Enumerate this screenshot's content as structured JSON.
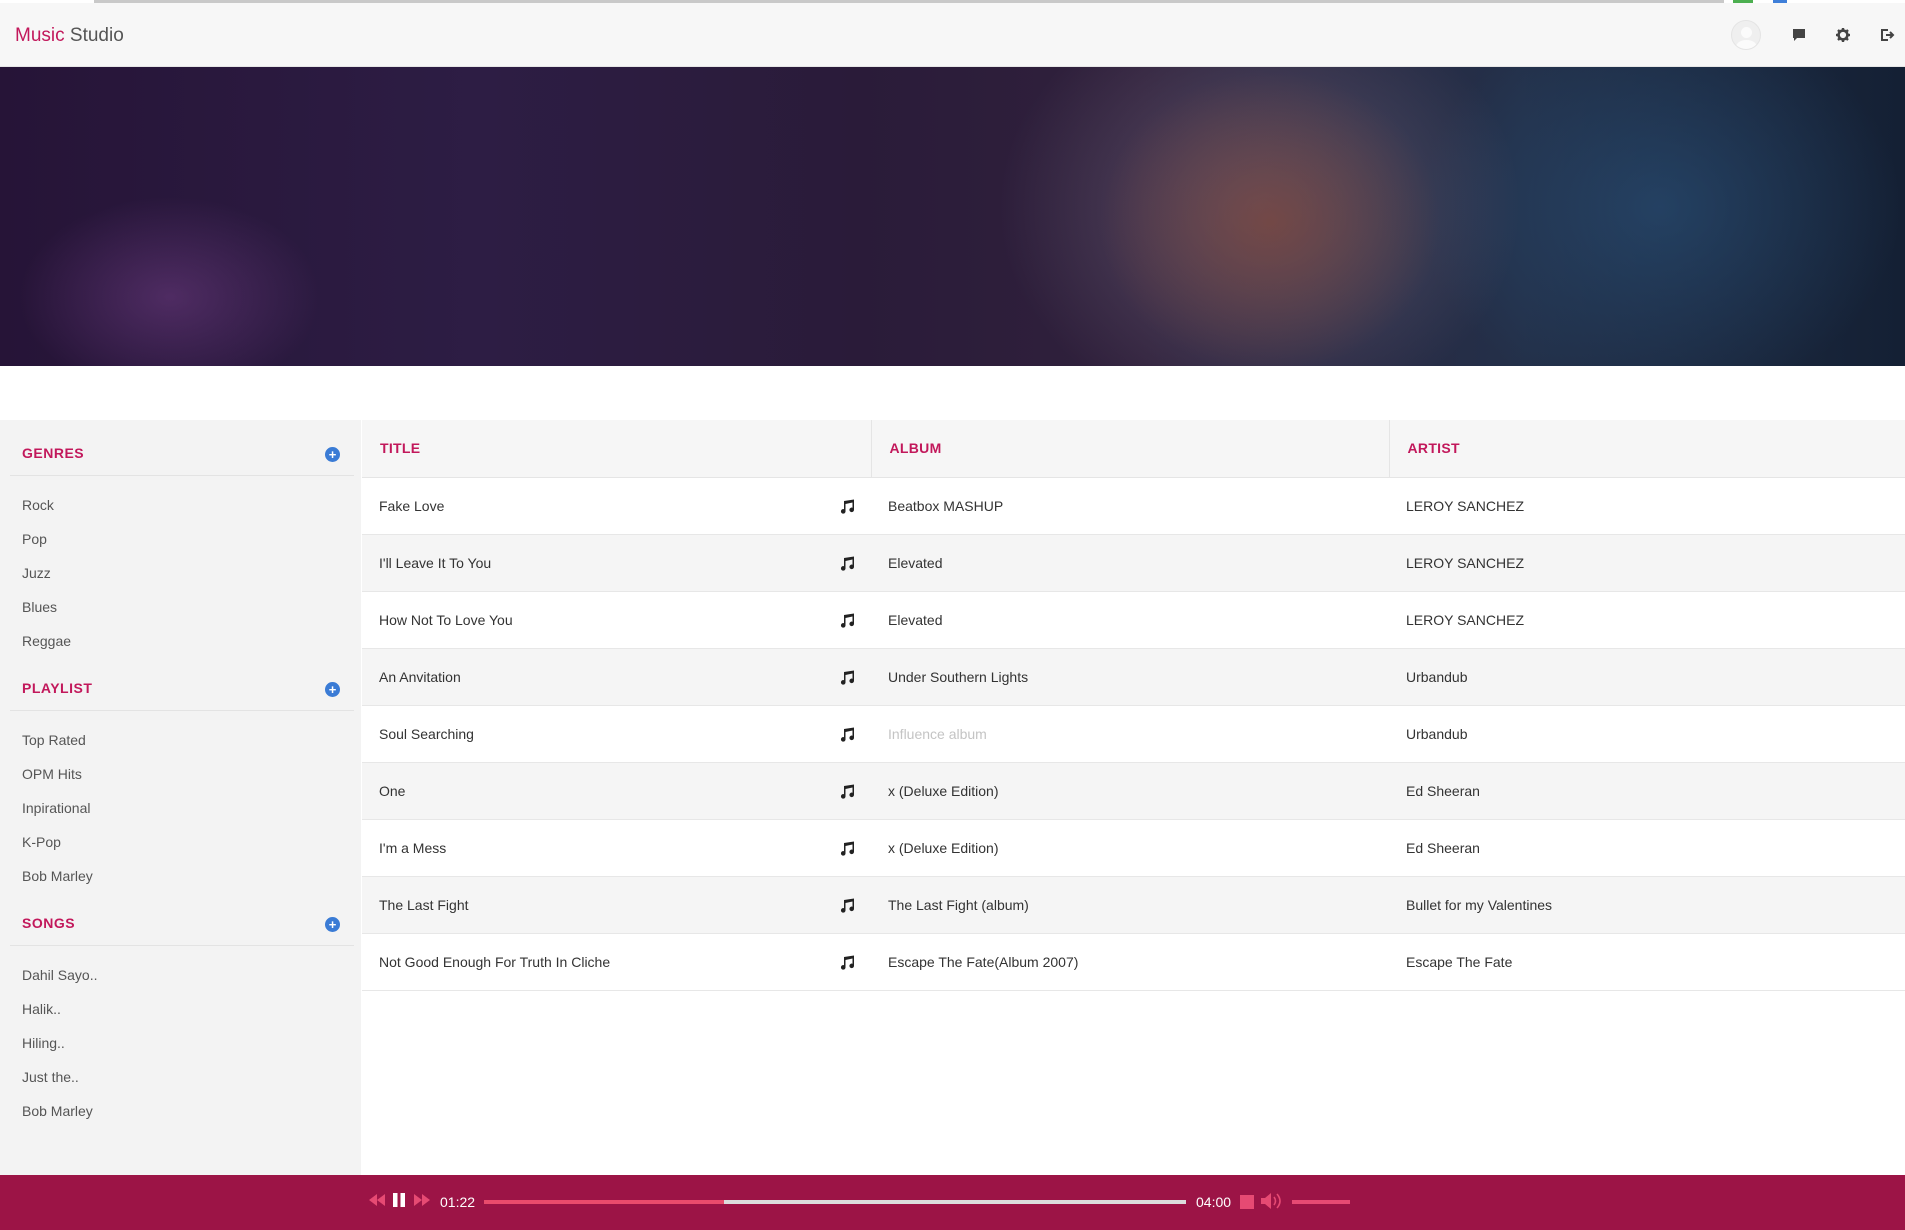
{
  "app": {
    "brand_accent": "Music",
    "brand_rest": " Studio"
  },
  "header_icons": [
    "avatar",
    "chat-icon",
    "gear-icon",
    "logout-icon"
  ],
  "sidebar": {
    "genres": {
      "title": "GENRES",
      "items": [
        "Rock",
        "Pop",
        "Juzz",
        "Blues",
        "Reggae"
      ]
    },
    "playlist": {
      "title": "PLAYLIST",
      "items": [
        "Top Rated",
        "OPM Hits",
        "Inpirational",
        "K-Pop",
        "Bob Marley"
      ]
    },
    "songs": {
      "title": "SONGS",
      "items": [
        "Dahil Sayo..",
        "Halik..",
        "Hiling..",
        "Just the..",
        "Bob Marley"
      ]
    }
  },
  "table": {
    "columns": [
      "TITLE",
      "ALBUM",
      "ARTIST"
    ],
    "rows": [
      {
        "title": "Fake Love",
        "album": "Beatbox MASHUP",
        "artist": "LEROY SANCHEZ"
      },
      {
        "title": "I'll Leave It To You",
        "album": "Elevated",
        "artist": "LEROY SANCHEZ"
      },
      {
        "title": "How Not To Love You",
        "album": "Elevated",
        "artist": "LEROY SANCHEZ"
      },
      {
        "title": "An Anvitation",
        "album": "Under Southern Lights",
        "artist": "Urbandub"
      },
      {
        "title": "Soul Searching",
        "album": "Influence album",
        "artist": "Urbandub",
        "album_faded": true
      },
      {
        "title": "One",
        "album": "x (Deluxe Edition)",
        "artist": "Ed Sheeran"
      },
      {
        "title": "I'm a Mess",
        "album": "x (Deluxe Edition)",
        "artist": "Ed Sheeran"
      },
      {
        "title": "The Last Fight",
        "album": "The Last Fight (album)",
        "artist": "Bullet for my Valentines"
      },
      {
        "title": "Not Good Enough For Truth In Cliche",
        "album": "Escape The Fate(Album 2007)",
        "artist": "Escape The Fate"
      }
    ]
  },
  "player": {
    "current_time": "01:22",
    "total_time": "04:00",
    "progress_fraction": 0.342,
    "state": "playing",
    "volume_fraction": 1.0
  },
  "colors": {
    "accent": "#c2185b",
    "player_bg": "#9c1446",
    "add_button": "#3a7bd5"
  }
}
